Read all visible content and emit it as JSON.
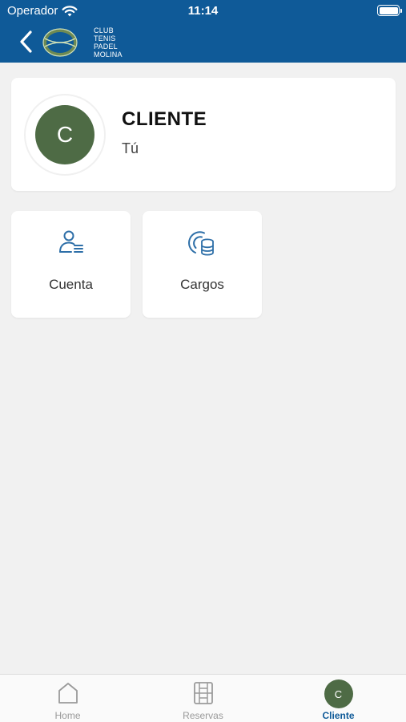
{
  "status_bar": {
    "carrier": "Operador",
    "time": "11:14",
    "battery_level": 1.0
  },
  "header": {
    "club_name_lines": [
      "CLUB",
      "TENIS",
      "PADEL",
      "MOLINA"
    ],
    "icons": {
      "back": "chevron-left-icon",
      "logo": "tennis-ball-logo"
    }
  },
  "profile": {
    "avatar_letter": "C",
    "name": "CLIENTE",
    "subtitle": "Tú"
  },
  "tiles": [
    {
      "label": "Cuenta",
      "icon": "user-list-icon"
    },
    {
      "label": "Cargos",
      "icon": "coins-icon"
    }
  ],
  "tab_bar": {
    "items": [
      {
        "label": "Home",
        "icon": "home-icon"
      },
      {
        "label": "Reservas",
        "icon": "court-icon"
      },
      {
        "label": "Cliente",
        "icon": "avatar",
        "avatar_letter": "C",
        "active": true
      }
    ]
  },
  "colors": {
    "brand_blue": "#0f5a98",
    "avatar_green": "#4e6b45",
    "background": "#f1f1f1",
    "icon_blue": "#2e6fa8"
  }
}
